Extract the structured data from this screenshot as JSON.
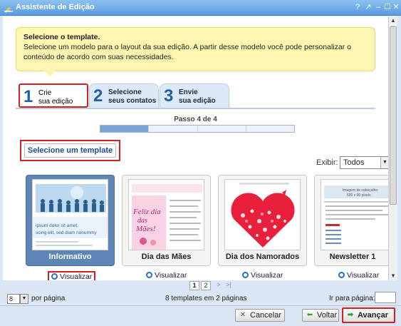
{
  "window": {
    "title": "Assistente de Edição",
    "controls": [
      "?",
      "↗",
      "–",
      "☐",
      "✕"
    ]
  },
  "help": {
    "title": "Selecione o template.",
    "body": "Selecione um modelo para o layout da sua edição. A partir desse modelo você pode personalizar o conteúdo de acordo com suas necessidades."
  },
  "steps": [
    {
      "num": "1",
      "line1": "Crie",
      "line2": "sua edição",
      "active": true
    },
    {
      "num": "2",
      "line1": "Selecione",
      "line2": "seus contatos",
      "active": false
    },
    {
      "num": "3",
      "line1": "Envie",
      "line2": "sua edição",
      "active": false
    }
  ],
  "progress": {
    "label": "Passo 4 de 4",
    "filled": 1,
    "segments": 4
  },
  "section_button": "Selecione um template",
  "filter": {
    "label": "Exibir:",
    "value": "Todos"
  },
  "templates": [
    {
      "name": "Informativo",
      "selected": true,
      "view": "Visualizar"
    },
    {
      "name": "Dia das Mães",
      "selected": false,
      "view": "Visualizar"
    },
    {
      "name": "Dia dos Namorados",
      "selected": false,
      "view": "Visualizar"
    },
    {
      "name": "Newsletter 1",
      "selected": false,
      "view": "Visualizar"
    }
  ],
  "thumb_text": {
    "info_line1": "ipsum dolor sit amet,",
    "info_line2": "scing elit, sed diam nonummy",
    "maes_line1": "Feliz dia",
    "maes_line2": "das",
    "maes_line3": "Mães!",
    "news_line1": "Imagem de cabeçalho",
    "news_line2": "600 x 90 pixels"
  },
  "pager": {
    "pages": [
      "1",
      "2"
    ],
    "next": ">",
    "last": ">|"
  },
  "footer": {
    "per_page_value": "8",
    "per_page_label": "por página",
    "summary": "8 templates em 2 páginas",
    "goto_label": "Ir para página:"
  },
  "actions": {
    "cancel": "Cancelar",
    "back": "Voltar",
    "next": "Avançar"
  },
  "colors": {
    "highlight": "#d42020",
    "accent": "#1f5ea8",
    "selected_card": "#5d86b6"
  }
}
